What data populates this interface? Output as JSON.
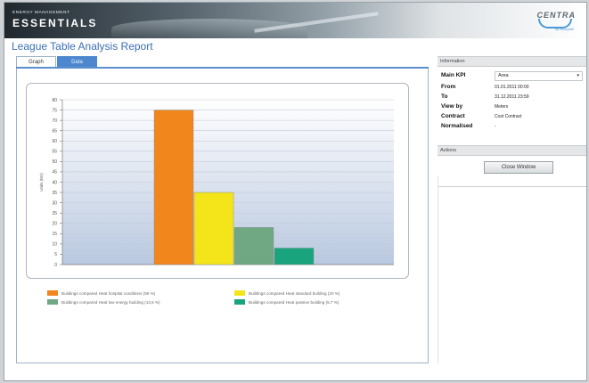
{
  "banner": {
    "brand_small": "ENERGY MANAGEMENT",
    "brand_large": "ESSENTIALS",
    "logo_text": "CENTRA",
    "logo_sub": "by Honeywell"
  },
  "page_title": "League Table Analysis Report",
  "tabs": [
    {
      "label": "Graph",
      "active": true
    },
    {
      "label": "Data",
      "active": false
    }
  ],
  "chart_data": {
    "type": "bar",
    "ylabel": "Units (MJ)",
    "ylim": [
      0,
      80
    ],
    "yticks": [
      "80",
      "75",
      "70",
      "65",
      "60",
      "55",
      "50",
      "45",
      "40",
      "35",
      "30",
      "25",
      "20",
      "15",
      "10",
      "5",
      "0"
    ],
    "categories": [
      "Buildings compared Heat hospital conditions (55 %)",
      "Buildings compared Heat standard building (20 %)",
      "Buildings compared Heat low energy building (13,5 %)",
      "Buildings compared Heat passive building (5,7 %)"
    ],
    "values": [
      75,
      35,
      18,
      8
    ],
    "colors": [
      "#f0861c",
      "#f4e51a",
      "#6fa882",
      "#1aa47d"
    ]
  },
  "information": {
    "header": "Information",
    "rows": [
      {
        "label": "Main KPI",
        "value": "Area"
      },
      {
        "label": "From",
        "value": "01.01.2011 00:00"
      },
      {
        "label": "To",
        "value": "31.12.2011 23:59"
      },
      {
        "label": "View by",
        "value": "Meters"
      },
      {
        "label": "Contract",
        "value": "Cost Contract"
      },
      {
        "label": "Normalised",
        "value": "-"
      }
    ]
  },
  "actions": {
    "header": "Actions",
    "close_label": "Close Window"
  }
}
